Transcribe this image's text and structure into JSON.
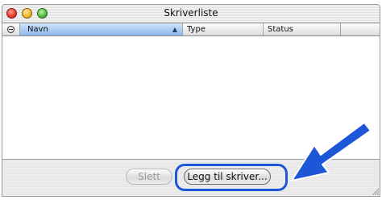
{
  "window": {
    "title": "Skriverliste"
  },
  "table": {
    "header_icon": "minus-circle-icon",
    "columns": [
      "Navn",
      "Type",
      "Status",
      ""
    ],
    "sorted_column": "Navn",
    "sort_direction": "ascending",
    "rows": []
  },
  "buttons": {
    "delete_label": "Slett",
    "add_label": "Legg til skriver..."
  },
  "colors": {
    "accent": "#1d56d6",
    "header_selected": "#8fb8ec"
  }
}
